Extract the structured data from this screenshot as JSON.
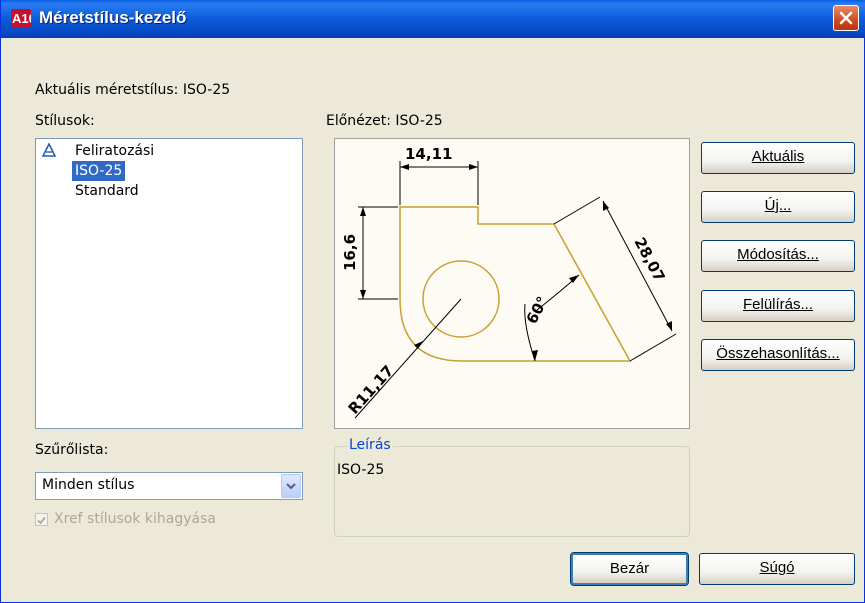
{
  "window": {
    "title": "Méretstílus-kezelő",
    "accent_color": "#0a5fe3",
    "close_button_color": "#d14a1c",
    "app_icon": "app-logo-icon",
    "app_icon_text": "A10"
  },
  "current_style": {
    "label": "Aktuális méretstílus: ISO-25"
  },
  "styles": {
    "label": "Stílusok:",
    "items": [
      {
        "label": "Feliratozási",
        "icon": "annotative-icon",
        "selected": false
      },
      {
        "label": "ISO-25",
        "selected": true
      },
      {
        "label": "Standard",
        "selected": false
      }
    ]
  },
  "filter": {
    "label": "Szűrőlista:",
    "selected": "Minden stílus",
    "xref_checkbox_label": "Xref stílusok kihagyása",
    "xref_checked": true,
    "xref_disabled": true
  },
  "preview": {
    "label": "Előnézet: ISO-25",
    "dims": {
      "top": "14,11",
      "left": "16,6",
      "diagonal": "28,07",
      "angle": "60°",
      "radius": "R11,17"
    },
    "geometry_color": "#c8a030"
  },
  "description": {
    "title": "Leírás",
    "text": "ISO-25"
  },
  "buttons": {
    "set_current": "Aktuális",
    "new": "Új...",
    "modify": "Módosítás...",
    "override": "Felülírás...",
    "compare": "Összehasonlítás...",
    "close": "Bezár",
    "help": "Súgó"
  }
}
